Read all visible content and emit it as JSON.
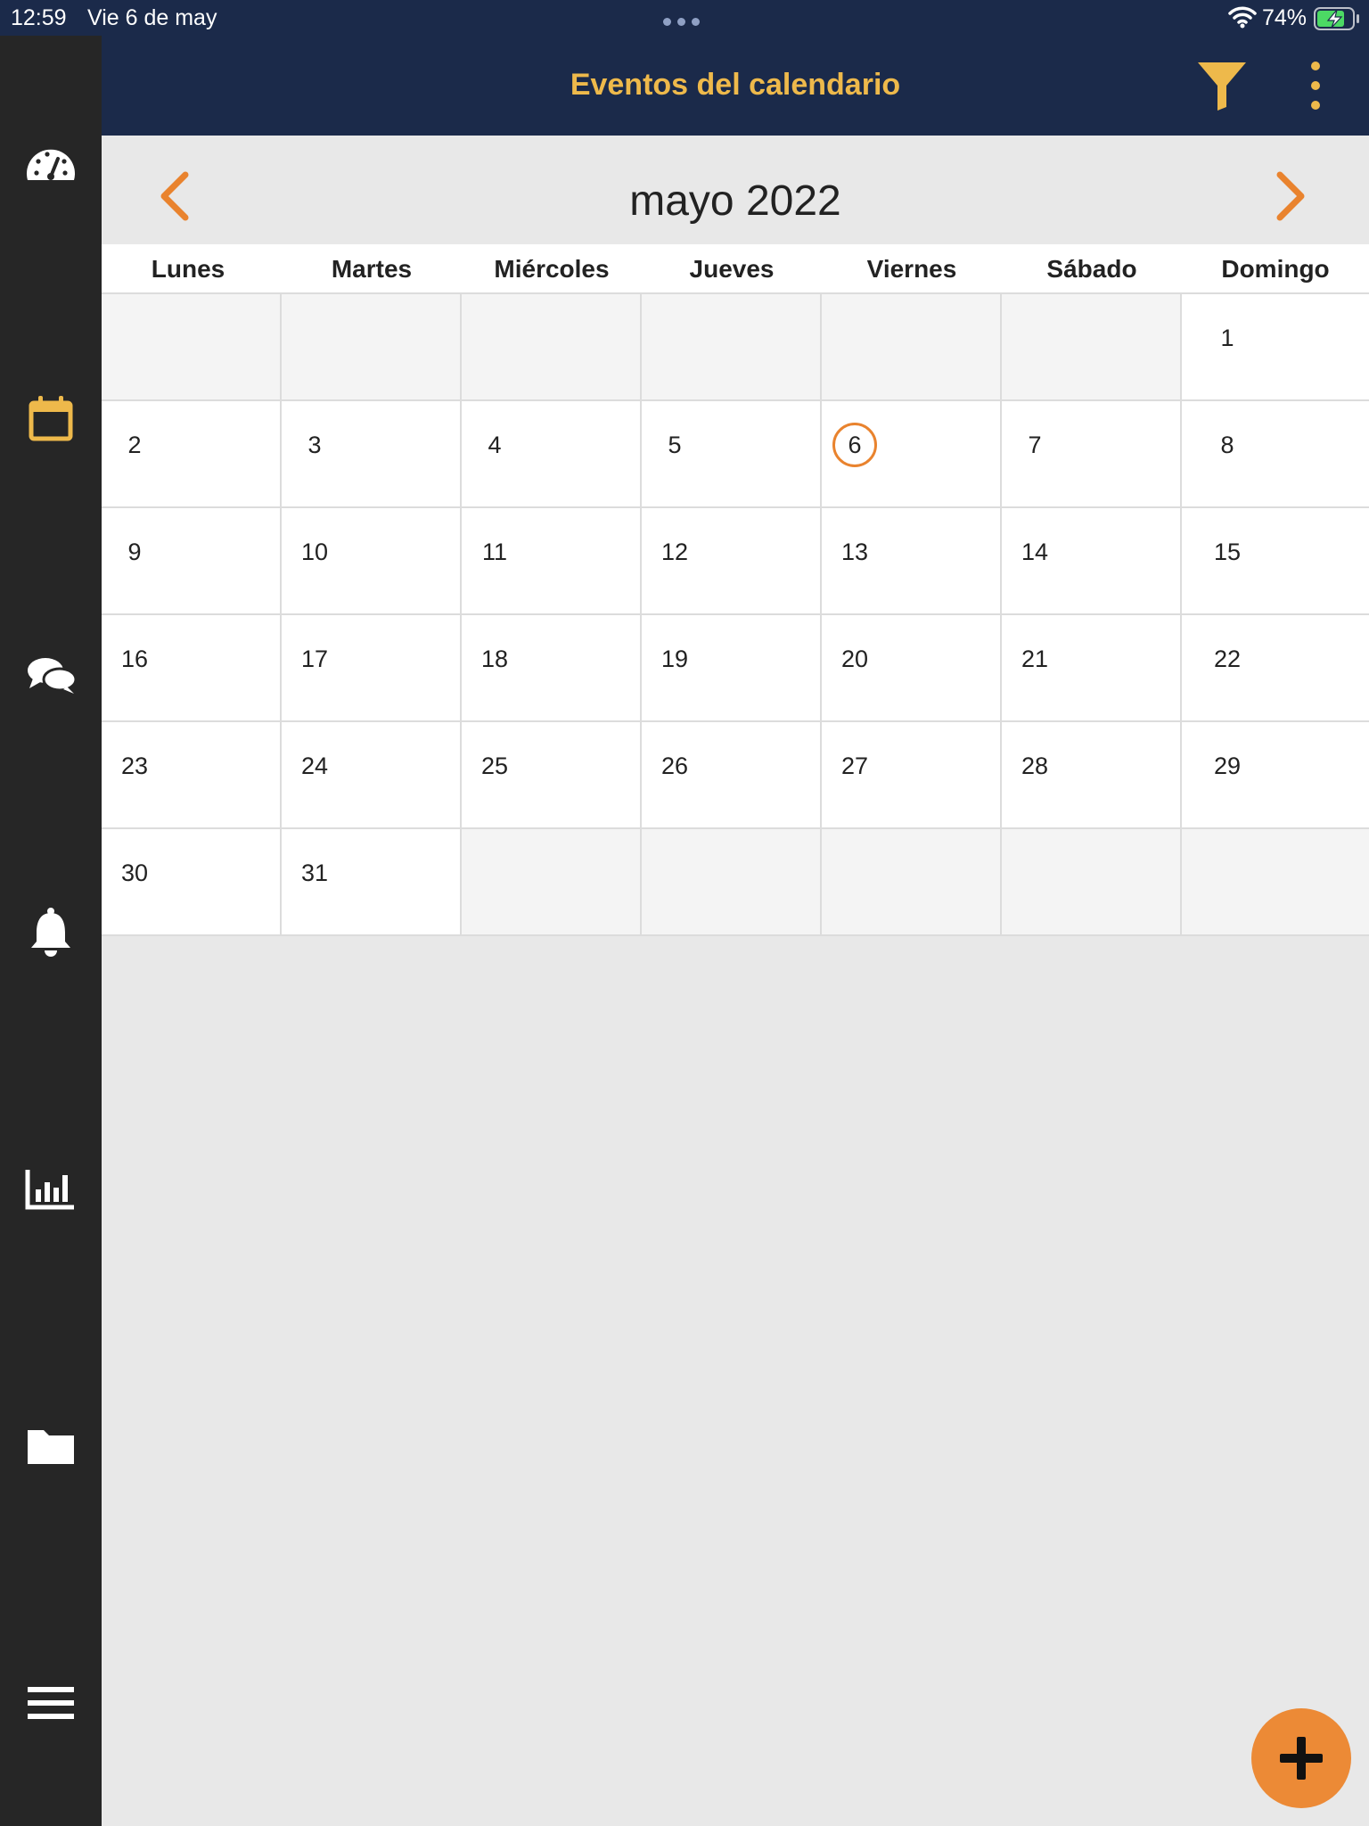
{
  "status_bar": {
    "time": "12:59",
    "date": "Vie 6 de may",
    "battery_percent": "74%",
    "battery_level": 0.74,
    "charging": true
  },
  "header": {
    "title": "Eventos del calendario",
    "title_color": "#eeb94b",
    "background": "#1b2a4a",
    "icons": [
      "filter-icon",
      "more-vertical-icon"
    ]
  },
  "sidebar": {
    "background": "#262626",
    "items": [
      {
        "icon": "dashboard-icon",
        "active": false
      },
      {
        "icon": "calendar-icon",
        "active": true
      },
      {
        "icon": "chat-icon",
        "active": false
      },
      {
        "icon": "bell-icon",
        "active": false
      },
      {
        "icon": "bar-chart-icon",
        "active": false
      },
      {
        "icon": "folder-icon",
        "active": false
      },
      {
        "icon": "menu-icon",
        "active": false
      }
    ],
    "active_color": "#eeb94b"
  },
  "calendar": {
    "month_title": "mayo 2022",
    "prev_icon": "chevron-left-icon",
    "next_icon": "chevron-right-icon",
    "accent_color": "#e9832e",
    "weekdays": [
      "Lunes",
      "Martes",
      "Miércoles",
      "Jueves",
      "Viernes",
      "Sábado",
      "Domingo"
    ],
    "weeks": [
      [
        "",
        "",
        "",
        "",
        "",
        "",
        "1"
      ],
      [
        "2",
        "3",
        "4",
        "5",
        "6",
        "7",
        "8"
      ],
      [
        "9",
        "10",
        "11",
        "12",
        "13",
        "14",
        "15"
      ],
      [
        "16",
        "17",
        "18",
        "19",
        "20",
        "21",
        "22"
      ],
      [
        "23",
        "24",
        "25",
        "26",
        "27",
        "28",
        "29"
      ],
      [
        "30",
        "31",
        "",
        "",
        "",
        "",
        ""
      ]
    ],
    "today": "6"
  },
  "fab": {
    "icon": "plus-icon",
    "color": "#ec8a36"
  }
}
